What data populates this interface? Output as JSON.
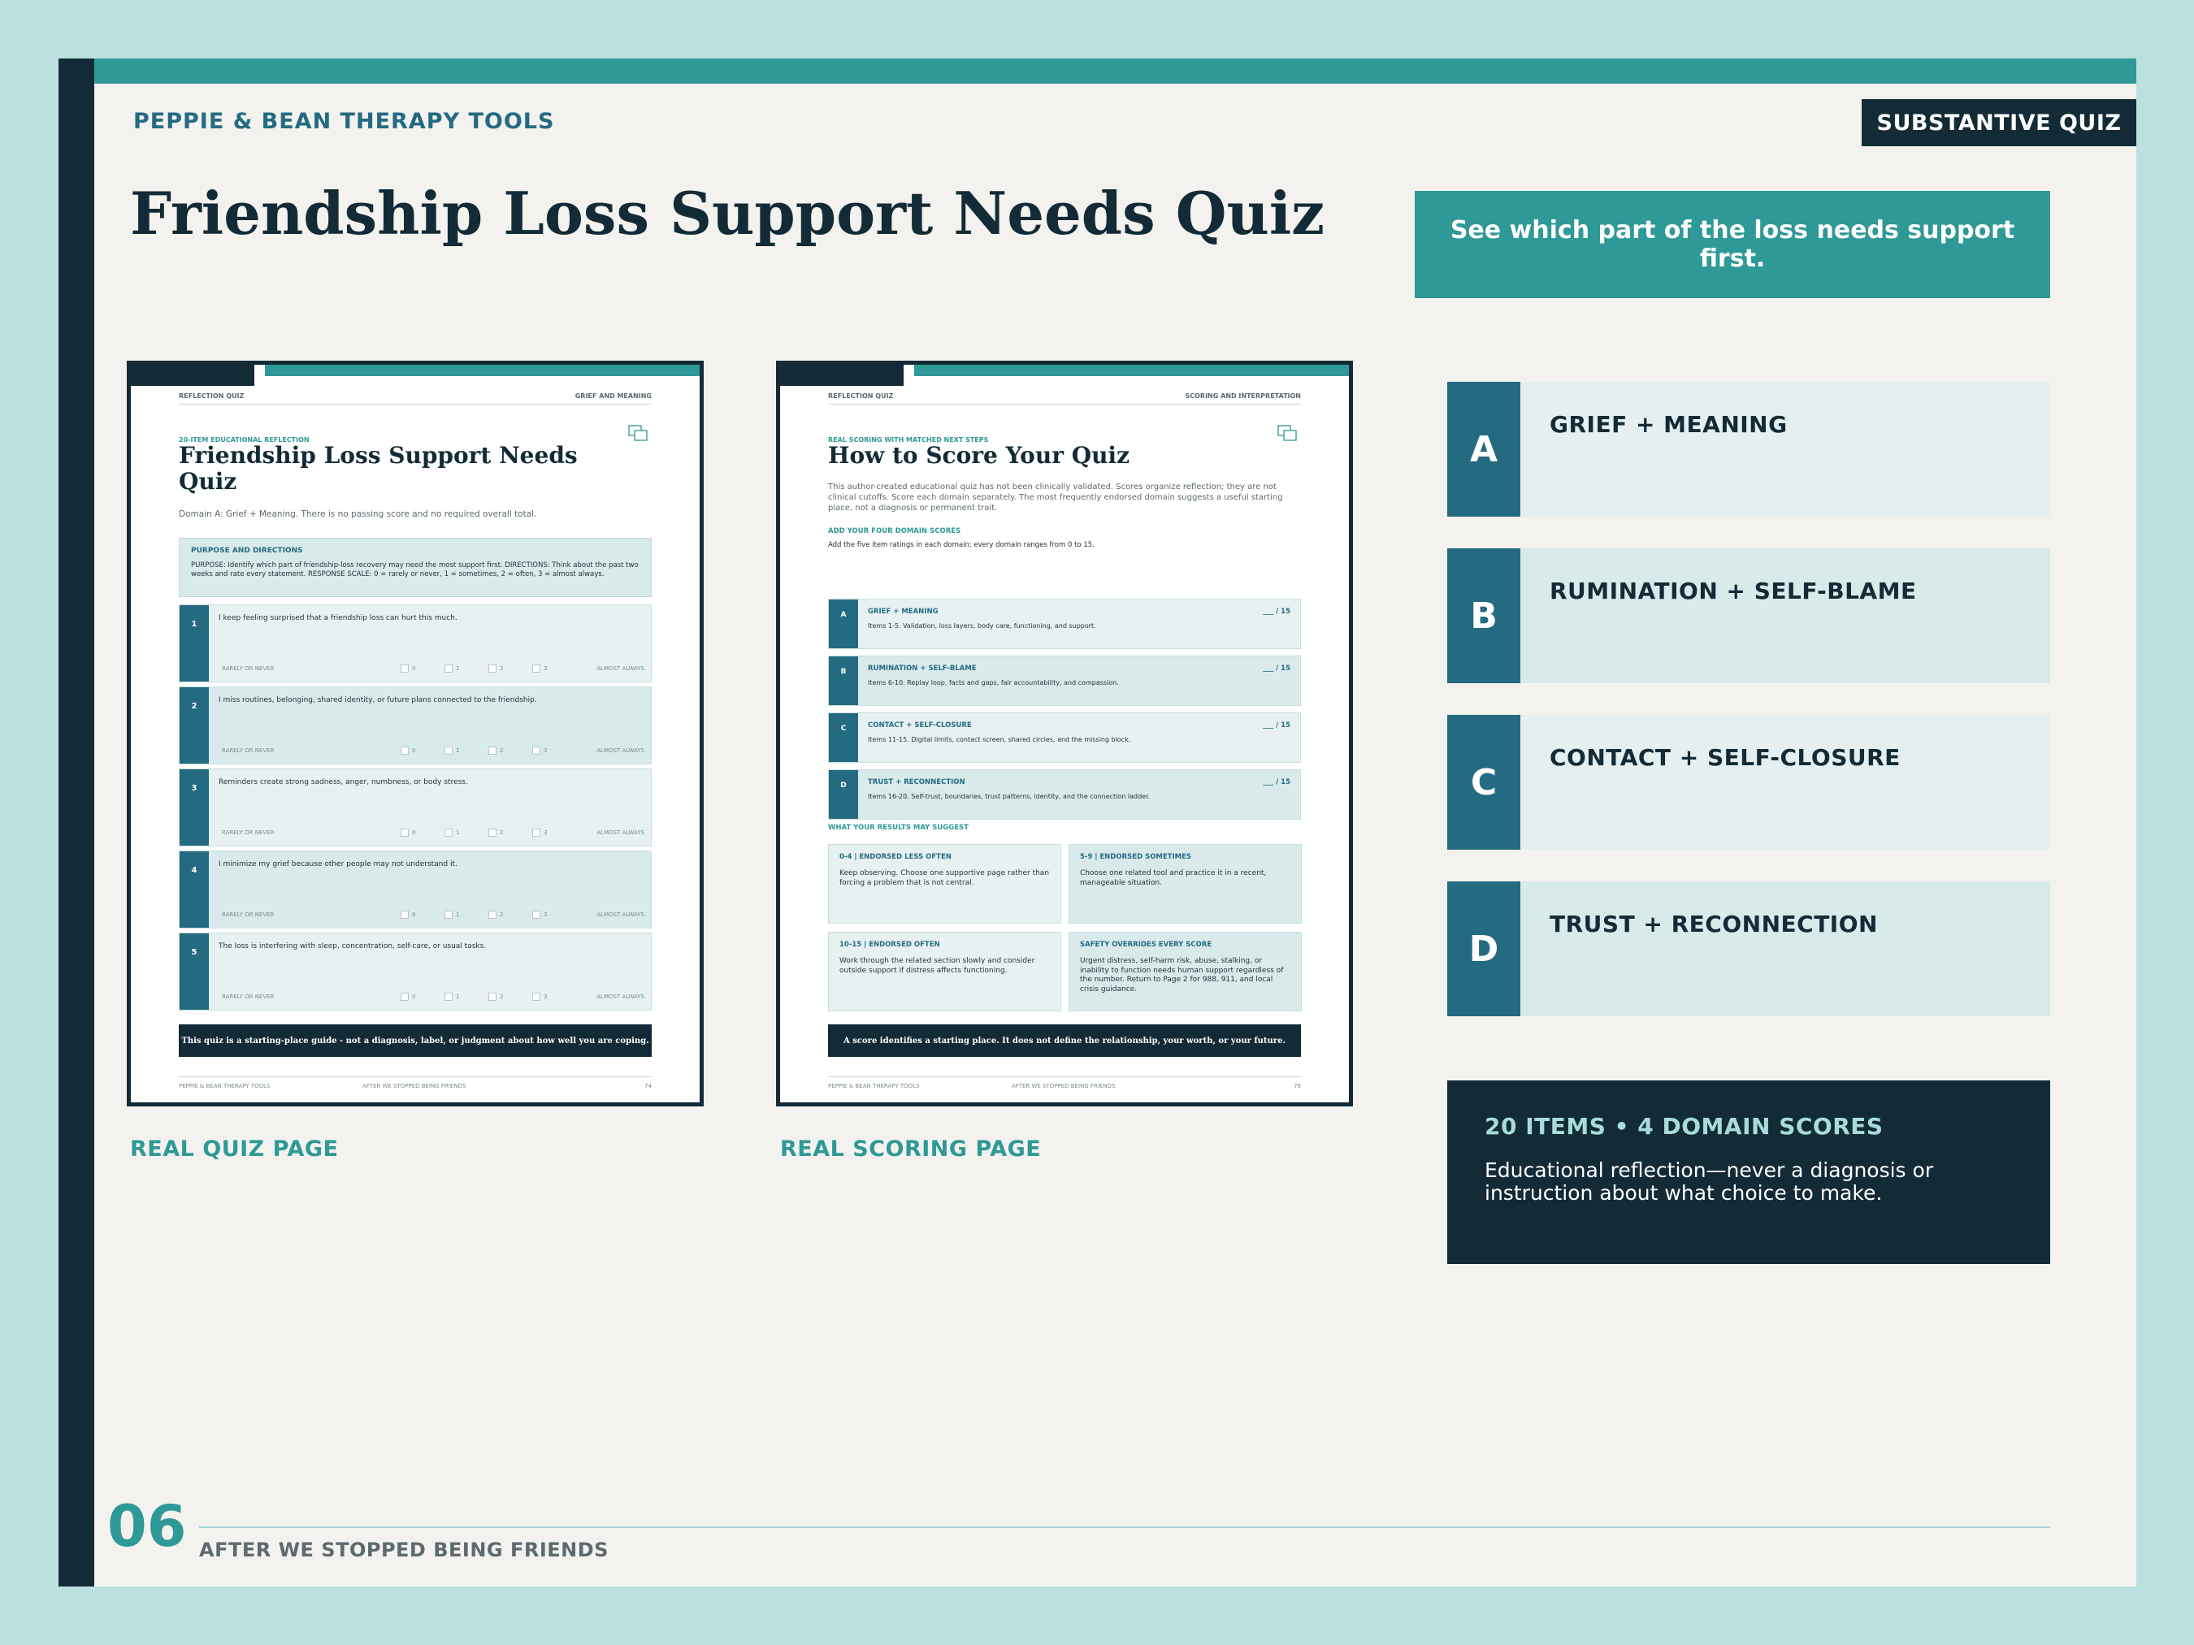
{
  "header": {
    "brand": "PEPPIE & BEAN THERAPY TOOLS",
    "tag": "SUBSTANTIVE QUIZ",
    "title": "Friendship Loss Support Needs Quiz",
    "callout": "See which part of the loss needs support first."
  },
  "quiz_page": {
    "header_left": "REFLECTION QUIZ",
    "header_right": "GRIEF AND MEANING",
    "eyebrow": "20-ITEM EDUCATIONAL REFLECTION",
    "title": "Friendship Loss Support Needs Quiz",
    "subtitle": "Domain A: Grief + Meaning. There is no passing score and no required overall total.",
    "purpose_heading": "PURPOSE AND DIRECTIONS",
    "purpose_text": "PURPOSE: Identify which part of friendship-loss recovery may need the most support first. DIRECTIONS: Think about the past two weeks and rate every statement. RESPONSE SCALE: 0 = rarely or never, 1 = sometimes, 2 = often, 3 = almost always.",
    "scale_low": "RARELY OR NEVER",
    "scale_high": "ALMOST ALWAYS",
    "scale_options": [
      "0",
      "1",
      "2",
      "3"
    ],
    "items": [
      {
        "num": "1",
        "text": "I keep feeling surprised that a friendship loss can hurt this much."
      },
      {
        "num": "2",
        "text": "I miss routines, belonging, shared identity, or future plans connected to the friendship."
      },
      {
        "num": "3",
        "text": "Reminders create strong sadness, anger, numbness, or body stress."
      },
      {
        "num": "4",
        "text": "I minimize my grief because other people may not understand it."
      },
      {
        "num": "5",
        "text": "The loss is interfering with sleep, concentration, self-care, or usual tasks."
      }
    ],
    "footnote": "This quiz is a starting-place guide - not a diagnosis, label, or judgment about how well you are coping.",
    "footer_left": "PEPPIE & BEAN THERAPY TOOLS",
    "footer_center": "AFTER WE STOPPED BEING FRIENDS",
    "footer_right": "74"
  },
  "scoring_page": {
    "header_left": "REFLECTION QUIZ",
    "header_right": "SCORING AND INTERPRETATION",
    "eyebrow": "REAL SCORING WITH MATCHED NEXT STEPS",
    "title": "How to Score Your Quiz",
    "intro": "This author-created educational quiz has not been clinically validated. Scores organize reflection; they are not clinical cutoffs. Score each domain separately. The most frequently endorsed domain suggests a useful starting place, not a diagnosis or permanent trait.",
    "add_label": "ADD YOUR FOUR DOMAIN SCORES",
    "add_text": "Add the five item ratings in each domain; every domain ranges from 0 to 15.",
    "domains": [
      {
        "letter": "A",
        "name": "GRIEF + MEANING",
        "desc": "Items 1-5. Validation, loss layers, body care, functioning, and support.",
        "score": "___ / 15"
      },
      {
        "letter": "B",
        "name": "RUMINATION + SELF-BLAME",
        "desc": "Items 6-10. Replay loop, facts and gaps, fair accountability, and compassion.",
        "score": "___ / 15"
      },
      {
        "letter": "C",
        "name": "CONTACT + SELF-CLOSURE",
        "desc": "Items 11-15. Digital limits, contact screen, shared circles, and the missing block.",
        "score": "___ / 15"
      },
      {
        "letter": "D",
        "name": "TRUST + RECONNECTION",
        "desc": "Items 16-20. Self-trust, boundaries, trust patterns, identity, and the connection ladder.",
        "score": "___ / 15"
      }
    ],
    "results_label": "WHAT YOUR RESULTS MAY SUGGEST",
    "results": [
      {
        "head": "0-4 | ENDORSED LESS OFTEN",
        "body": "Keep observing. Choose one supportive page rather than forcing a problem that is not central."
      },
      {
        "head": "5-9 | ENDORSED SOMETIMES",
        "body": "Choose one related tool and practice it in a recent, manageable situation."
      },
      {
        "head": "10-15 | ENDORSED OFTEN",
        "body": "Work through the related section slowly and consider outside support if distress affects functioning."
      },
      {
        "head": "SAFETY OVERRIDES EVERY SCORE",
        "body": "Urgent distress, self-harm risk, abuse, stalking, or inability to function needs human support regardless of the number. Return to Page 2 for 988, 911, and local crisis guidance."
      }
    ],
    "footnote": "A score identifies a starting place. It does not define the relationship, your worth, or your future.",
    "footer_left": "PEPPIE & BEAN THERAPY TOOLS",
    "footer_center": "AFTER WE STOPPED BEING FRIENDS",
    "footer_right": "78"
  },
  "captions": {
    "quiz": "REAL QUIZ PAGE",
    "scoring": "REAL SCORING PAGE"
  },
  "domains": [
    {
      "letter": "A",
      "name": "GRIEF + MEANING"
    },
    {
      "letter": "B",
      "name": "RUMINATION + SELF-BLAME"
    },
    {
      "letter": "C",
      "name": "CONTACT + SELF-CLOSURE"
    },
    {
      "letter": "D",
      "name": "TRUST + RECONNECTION"
    }
  ],
  "summary": {
    "heading": "20 ITEMS • 4 DOMAIN SCORES",
    "body": "Educational reflection—never a diagnosis or instruction about what choice to make."
  },
  "footer": {
    "page_number": "06",
    "book_title": "AFTER WE STOPPED BEING FRIENDS"
  },
  "colors": {
    "navy": "#132b36",
    "teal": "#2e9996",
    "blue": "#246b82",
    "paper": "#f3f2ee",
    "frame": "#bcdfdf"
  },
  "icons": [
    "copy-pages-icon"
  ]
}
